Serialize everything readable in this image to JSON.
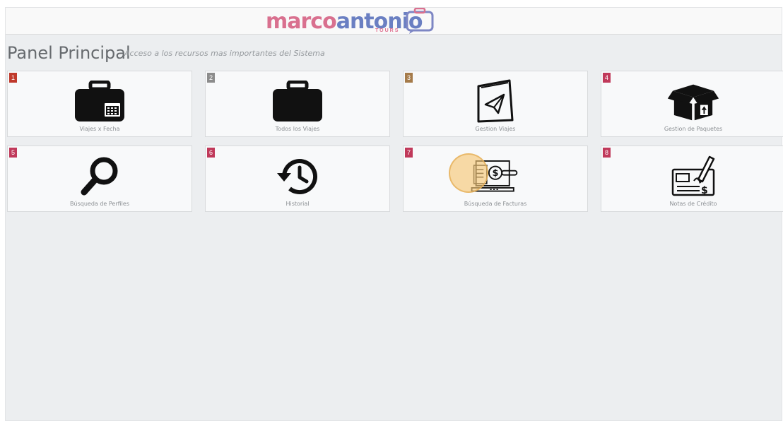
{
  "brand": {
    "word1": "marco",
    "word2": "antonio",
    "tagline": "TOURS",
    "colors": {
      "pink": "#d9708f",
      "blue": "#6a7fc2"
    }
  },
  "header": {
    "title": "Panel Principal",
    "subtitle": "Acceso a los recursos mas importantes del Sistema"
  },
  "tiles": [
    {
      "number": "1",
      "label": "Viajes x Fecha",
      "icon": "briefcase-calendar-icon",
      "badge_color": "#c0392b"
    },
    {
      "number": "2",
      "label": "Todos los Viajes",
      "icon": "briefcase-icon",
      "badge_color": "#8c8c8c"
    },
    {
      "number": "3",
      "label": "Gestion Viajes",
      "icon": "paper-plane-icon",
      "badge_color": "#a57b4a"
    },
    {
      "number": "4",
      "label": "Gestion de Paquetes",
      "icon": "open-box-icon",
      "badge_color": "#c0395a"
    },
    {
      "number": "5",
      "label": "Búsqueda de Perfiles",
      "icon": "magnifier-icon",
      "badge_color": "#c0395a"
    },
    {
      "number": "6",
      "label": "Historial",
      "icon": "history-icon",
      "badge_color": "#c0395a"
    },
    {
      "number": "7",
      "label": "Búsqueda de Facturas",
      "icon": "invoice-laptop-icon",
      "badge_color": "#c0395a"
    },
    {
      "number": "8",
      "label": "Notas de Crédito",
      "icon": "check-pen-icon",
      "badge_color": "#c0395a"
    }
  ]
}
